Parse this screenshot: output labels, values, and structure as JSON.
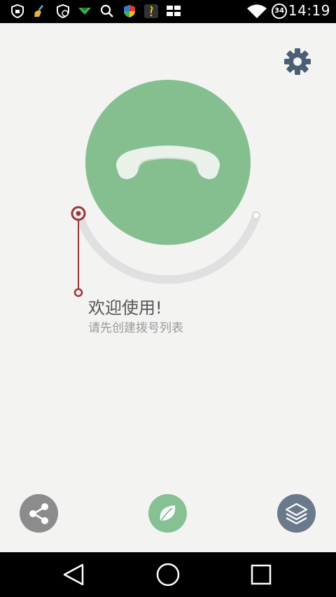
{
  "status_bar": {
    "time": "14:19",
    "battery_level": "34",
    "icons": [
      "shield-icon",
      "broom-icon",
      "shield-refresh-icon",
      "message-arrow-icon",
      "search-icon",
      "shield-color-icon",
      "notification-icon",
      "grid-icon",
      "wifi-icon"
    ]
  },
  "main": {
    "welcome_title": "欢迎使用!",
    "welcome_subtitle": "请先创建拨号列表"
  },
  "actions": {
    "settings": "gear-icon",
    "share": "share-icon",
    "leaf": "leaf-icon",
    "layers": "layers-icon"
  },
  "nav": {
    "buttons": [
      "back-icon",
      "home-icon",
      "recents-icon"
    ]
  },
  "colors": {
    "circle_green": "#85bf90",
    "accent_red": "#9e3438",
    "gear_blue": "#4a5f74",
    "share_gray": "#8c8c8c",
    "layers_slate": "#6b7a8b"
  }
}
